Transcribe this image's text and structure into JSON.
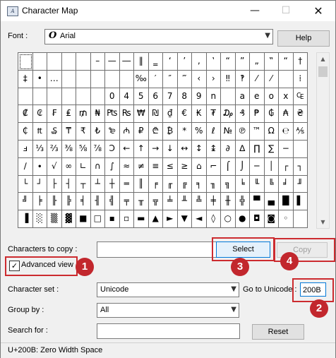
{
  "window": {
    "title": "Character Map",
    "minimize": "—",
    "maximize": "☐",
    "close": "✕"
  },
  "font": {
    "label": "Font :",
    "value": "Arial",
    "icon_glyph": "O",
    "help_label": "Help"
  },
  "grid": {
    "selected_index": 0,
    "rows": [
      [
        "",
        "",
        "",
        "",
        "",
        "–",
        "—",
        "―",
        "‖",
        "‗",
        "‘",
        "’",
        "‚",
        "‛",
        "“",
        "”",
        "„",
        "‟",
        "“",
        "†"
      ],
      [
        "‡",
        "•",
        "…",
        "",
        "",
        "",
        "",
        "",
        "‰",
        "′",
        "″",
        "‴",
        "‹",
        "›",
        "‼",
        "‽",
        "⁄",
        "⁄",
        "",
        "⁞"
      ],
      [
        "",
        "",
        "",
        "",
        "",
        "",
        "0",
        "4",
        "5",
        "6",
        "7",
        "8",
        "9",
        "n",
        "",
        "a",
        "e",
        "o",
        "x",
        "₠"
      ],
      [
        "₡",
        "₢",
        "₣",
        "₤",
        "₥",
        "₦",
        "₧",
        "₨",
        "₩",
        "₪",
        "₫",
        "€",
        "₭",
        "₮",
        "₯",
        "₰",
        "₱",
        "₲",
        "₳",
        "₴"
      ],
      [
        "₵",
        "₶",
        "₷",
        "₸",
        "₹",
        "₺",
        "₻",
        "₼",
        "₽",
        "₾",
        "₿",
        "*",
        "%",
        "ℓ",
        "№",
        "℗",
        "™",
        "Ω",
        "℮",
        "⅍"
      ],
      [
        "ⅎ",
        "⅓",
        "⅔",
        "⅜",
        "⅝",
        "⅞",
        "Ↄ",
        "←",
        "↑",
        "→",
        "↓",
        "↔",
        "↕",
        "↨",
        "∂",
        "∆",
        "∏",
        "∑",
        "−",
        ""
      ],
      [
        "∕",
        "∙",
        "√",
        "∞",
        "∟",
        "∩",
        "∫",
        "≈",
        "≠",
        "≡",
        "≤",
        "≥",
        "⌂",
        "⌐",
        "⌠",
        "⌡",
        "─",
        "│",
        "┌",
        "┐"
      ],
      [
        "└",
        "┘",
        "├",
        "┤",
        "┬",
        "┴",
        "┼",
        "═",
        "║",
        "╒",
        "╓",
        "╔",
        "╕",
        "╖",
        "╗",
        "╘",
        "╙",
        "╚",
        "╛",
        "╜"
      ],
      [
        "╝",
        "╞",
        "╟",
        "╠",
        "╡",
        "╢",
        "╣",
        "╤",
        "╥",
        "╦",
        "╧",
        "╨",
        "╩",
        "╪",
        "╫",
        "╬",
        "▀",
        "▄",
        "█",
        "▌"
      ],
      [
        "▐",
        "░",
        "▒",
        "▓",
        "■",
        "□",
        "▪",
        "▫",
        "▬",
        "▲",
        "►",
        "▼",
        "◄",
        "◊",
        "○",
        "●",
        "◘",
        "◙",
        "◦",
        ""
      ]
    ]
  },
  "chars_to_copy": {
    "label": "Characters to copy :",
    "value": ""
  },
  "select_button": "Select",
  "copy_button": "Copy",
  "advanced_view": {
    "label": "Advanced view",
    "checked": true,
    "check_glyph": "✓"
  },
  "character_set": {
    "label": "Character set :",
    "value": "Unicode"
  },
  "go_to_unicode": {
    "label": "Go to Unicode :",
    "value": "200B"
  },
  "group_by": {
    "label": "Group by :",
    "value": "All"
  },
  "search": {
    "label": "Search for :",
    "value": ""
  },
  "reset_button": "Reset",
  "status": "U+200B: Zero Width Space",
  "annotations": {
    "badge_1": "1",
    "badge_2": "2",
    "badge_3": "3",
    "badge_4": "4",
    "color": "#c2272d"
  }
}
